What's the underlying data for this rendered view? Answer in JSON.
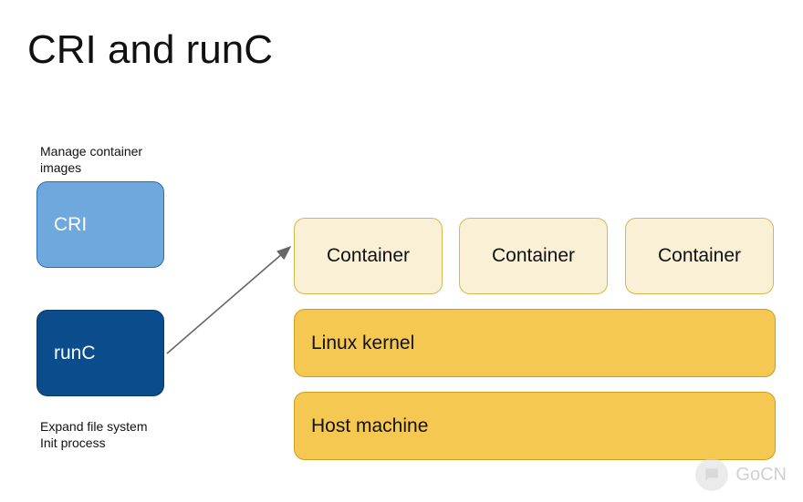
{
  "title": "CRI and runC",
  "captions": {
    "manage_images": "Manage container\nimages",
    "expand_init": "Expand file system\nInit process"
  },
  "boxes": {
    "cri": "CRI",
    "runc": "runC",
    "containers": [
      "Container",
      "Container",
      "Container"
    ],
    "kernel": "Linux kernel",
    "host": "Host machine"
  },
  "colors": {
    "cri_fill": "#6fa8dc",
    "runc_fill": "#0b4c8c",
    "container_fill": "#faf0d6",
    "stack_fill": "#f4c851"
  },
  "watermark": {
    "label": "GoCN",
    "icon": "chat-bubble-icon"
  }
}
